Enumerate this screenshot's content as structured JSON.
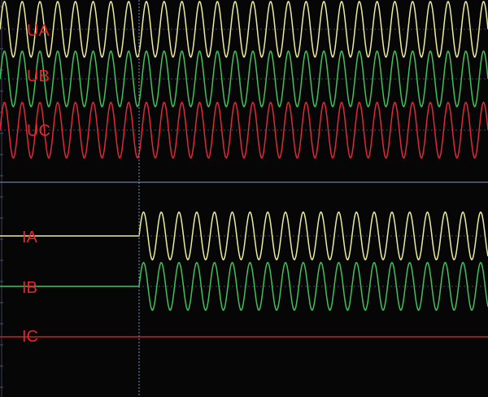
{
  "background_color": "#060606",
  "cursor_color": "#7a92b8",
  "divider_color": "#6f78a8",
  "channels": [
    {
      "label": "UA",
      "color": "#ecec9a",
      "amplitude_frac": 0.07,
      "cycles": 27.5,
      "start_fraction": 0
    },
    {
      "label": "UB",
      "color": "#3fc25a",
      "amplitude_frac": 0.07,
      "cycles": 27.5,
      "start_fraction": 0
    },
    {
      "label": "UC",
      "color": "#e0283a",
      "amplitude_frac": 0.07,
      "cycles": 27.5,
      "start_fraction": 0
    },
    {
      "label": "IA",
      "color": "#ecec9a",
      "amplitude_frac": 0.06,
      "cycles": 27.5,
      "start_fraction": 0.285
    },
    {
      "label": "IB",
      "color": "#3fc25a",
      "amplitude_frac": 0.06,
      "cycles": 27.5,
      "start_fraction": 0.285
    },
    {
      "label": "IC",
      "color": "#c81e2a",
      "amplitude_frac": 0,
      "cycles": 0,
      "start_fraction": 0
    }
  ]
}
